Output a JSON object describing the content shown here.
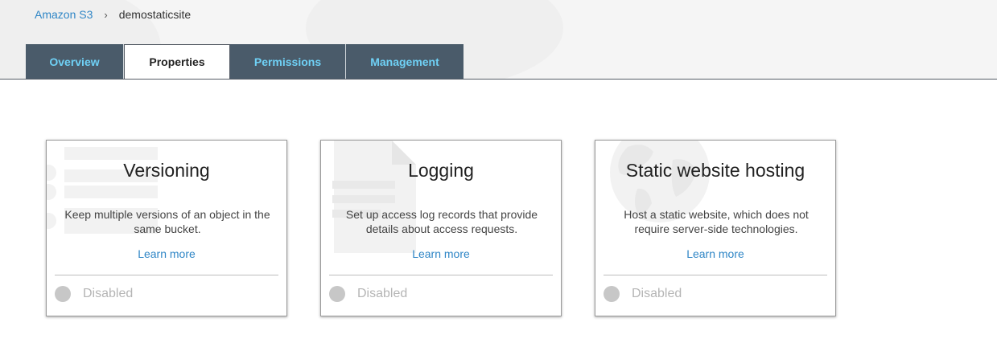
{
  "breadcrumb": {
    "root": "Amazon S3",
    "separator": "›",
    "current": "demostaticsite"
  },
  "tabs": [
    {
      "label": "Overview",
      "active": false
    },
    {
      "label": "Properties",
      "active": true
    },
    {
      "label": "Permissions",
      "active": false
    },
    {
      "label": "Management",
      "active": false
    }
  ],
  "cards": [
    {
      "title": "Versioning",
      "description": "Keep multiple versions of an object in the same bucket.",
      "learn_more": "Learn more",
      "status": "Disabled",
      "icon": "versioning-watermark-icon"
    },
    {
      "title": "Logging",
      "description": "Set up access log records that provide details about access requests.",
      "learn_more": "Learn more",
      "status": "Disabled",
      "icon": "document-watermark-icon"
    },
    {
      "title": "Static website hosting",
      "description": "Host a static website, which does not require server-side technologies.",
      "learn_more": "Learn more",
      "status": "Disabled",
      "icon": "globe-watermark-icon"
    }
  ],
  "colors": {
    "tab_bg": "#4a5b6a",
    "tab_text": "#6fd1f6",
    "link": "#2f86c6",
    "status_dot": "#c7c7c7"
  }
}
